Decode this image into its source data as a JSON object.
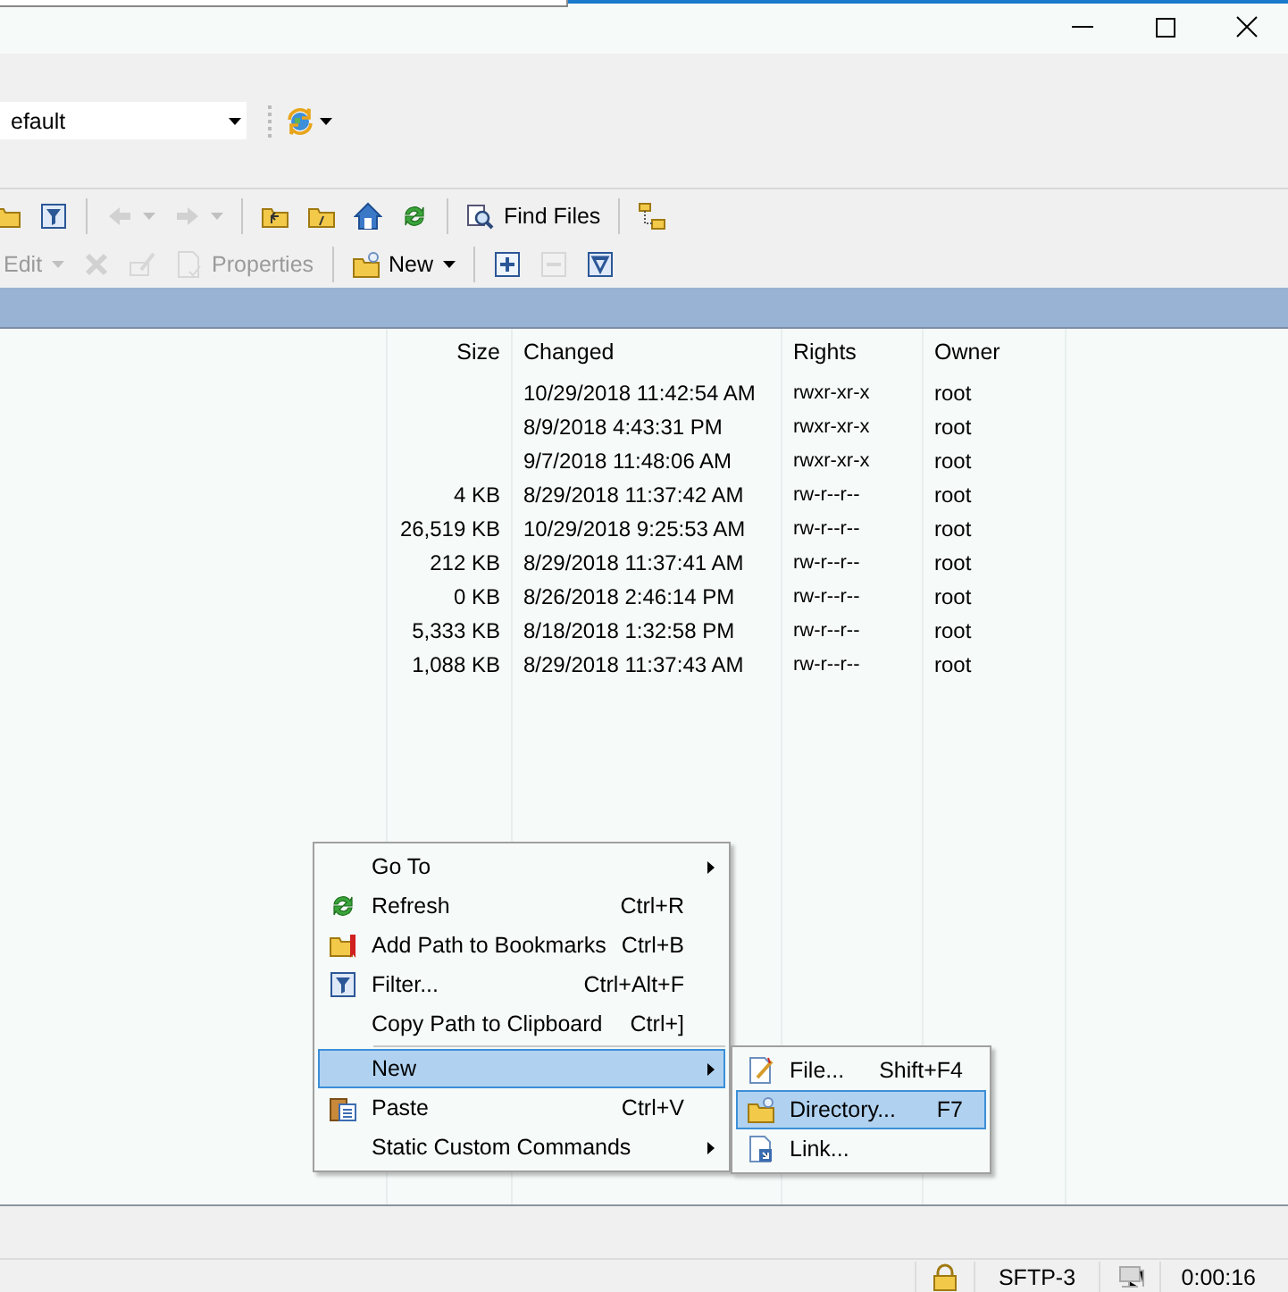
{
  "session_combo": {
    "value": "efault"
  },
  "toolbar_1": {
    "items": [
      {
        "kind": "icon",
        "disabled": false
      },
      {
        "kind": "icon",
        "disabled": false
      },
      {
        "kind": "separator"
      },
      {
        "kind": "icon",
        "disabled": true,
        "dropdown": true
      },
      {
        "kind": "icon",
        "disabled": true,
        "dropdown": true
      },
      {
        "kind": "separator"
      },
      {
        "kind": "icon",
        "disabled": false
      },
      {
        "kind": "icon",
        "disabled": false
      },
      {
        "kind": "icon",
        "disabled": false
      },
      {
        "kind": "icon",
        "disabled": false
      },
      {
        "kind": "separator"
      },
      {
        "kind": "button",
        "label": "Find Files",
        "disabled": false
      },
      {
        "kind": "separator"
      },
      {
        "kind": "icon",
        "disabled": false
      }
    ]
  },
  "toolbar_2": {
    "items": [
      {
        "kind": "text",
        "label": "Edit",
        "disabled": true,
        "dropdown": true
      },
      {
        "kind": "icon",
        "disabled": true
      },
      {
        "kind": "icon",
        "disabled": true
      },
      {
        "kind": "button",
        "label": "Properties",
        "disabled": true
      },
      {
        "kind": "separator"
      },
      {
        "kind": "button",
        "label": "New",
        "disabled": false,
        "dropdown": true
      },
      {
        "kind": "separator"
      },
      {
        "kind": "icon",
        "disabled": false
      },
      {
        "kind": "icon",
        "disabled": true
      },
      {
        "kind": "icon",
        "disabled": false
      }
    ]
  },
  "file_list": {
    "columns": [
      "Size",
      "Changed",
      "Rights",
      "Owner"
    ],
    "rows": [
      {
        "size": "",
        "changed": "10/29/2018 11:42:54 AM",
        "rights": "rwxr-xr-x",
        "owner": "root"
      },
      {
        "size": "",
        "changed": "8/9/2018 4:43:31 PM",
        "rights": "rwxr-xr-x",
        "owner": "root"
      },
      {
        "size": "",
        "changed": "9/7/2018 11:48:06 AM",
        "rights": "rwxr-xr-x",
        "owner": "root"
      },
      {
        "size": "4 KB",
        "changed": "8/29/2018 11:37:42 AM",
        "rights": "rw-r--r--",
        "owner": "root"
      },
      {
        "size": "26,519 KB",
        "changed": "10/29/2018 9:25:53 AM",
        "rights": "rw-r--r--",
        "owner": "root"
      },
      {
        "size": "212 KB",
        "changed": "8/29/2018 11:37:41 AM",
        "rights": "rw-r--r--",
        "owner": "root"
      },
      {
        "size": "0 KB",
        "changed": "8/26/2018 2:46:14 PM",
        "rights": "rw-r--r--",
        "owner": "root"
      },
      {
        "size": "5,333 KB",
        "changed": "8/18/2018 1:32:58 PM",
        "rights": "rw-r--r--",
        "owner": "root"
      },
      {
        "size": "1,088 KB",
        "changed": "8/29/2018 11:37:43 AM",
        "rights": "rw-r--r--",
        "owner": "root"
      }
    ]
  },
  "context_menu": {
    "items": [
      {
        "kind": "item",
        "label": "Go To",
        "submenu": true,
        "selected": false
      },
      {
        "kind": "item",
        "label": "Refresh",
        "shortcut": "Ctrl+R",
        "submenu": false,
        "selected": false
      },
      {
        "kind": "item",
        "label": "Add Path to Bookmarks",
        "shortcut": "Ctrl+B",
        "submenu": false,
        "selected": false
      },
      {
        "kind": "item",
        "label": "Filter...",
        "shortcut": "Ctrl+Alt+F",
        "submenu": false,
        "selected": false
      },
      {
        "kind": "item",
        "label": "Copy Path to Clipboard",
        "shortcut": "Ctrl+]",
        "submenu": false,
        "selected": false
      },
      {
        "kind": "separator"
      },
      {
        "kind": "item",
        "label": "New",
        "submenu": true,
        "selected": true
      },
      {
        "kind": "item",
        "label": "Paste",
        "shortcut": "Ctrl+V",
        "submenu": false,
        "selected": false
      },
      {
        "kind": "item",
        "label": "Static Custom Commands",
        "submenu": true,
        "selected": false
      }
    ]
  },
  "submenu": {
    "items": [
      {
        "label": "File...",
        "shortcut": "Shift+F4",
        "selected": false
      },
      {
        "label": "Directory...",
        "shortcut": "F7",
        "selected": true
      },
      {
        "label": "Link...",
        "selected": false
      }
    ]
  },
  "status_bar": {
    "protocol": "SFTP-3",
    "elapsed": "0:00:16"
  }
}
